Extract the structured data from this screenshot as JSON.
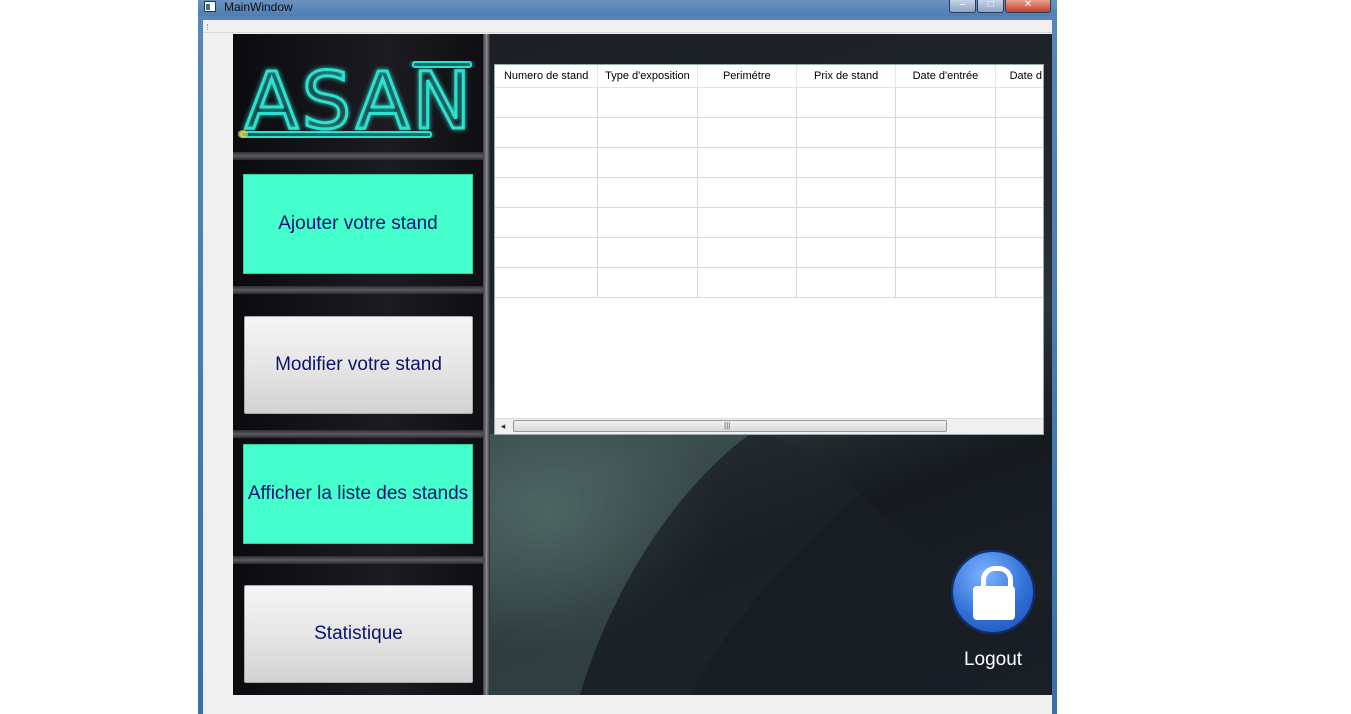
{
  "window": {
    "title": "MainWindow",
    "controls": {
      "minimize": "–",
      "maximize": "□",
      "close": "✕"
    }
  },
  "logo": {
    "text": "ASAN",
    "colors": {
      "glow": "#2de0d0",
      "accent": "#e8d040"
    }
  },
  "nav": {
    "add_stand": "Ajouter votre stand",
    "edit_stand": "Modifier votre stand",
    "list_stands": "Afficher la liste des stands",
    "statistics": "Statistique"
  },
  "table": {
    "columns": [
      "Numero de stand",
      "Type d'exposition",
      "Perimétre",
      "Prix de stand",
      "Date d'entrée",
      "Date d"
    ],
    "row_count": 7,
    "scrollbar": {
      "left_arrow": "◂",
      "grip": "|||"
    }
  },
  "logout": {
    "label": "Logout",
    "icon": "lock-icon"
  },
  "colors": {
    "teal_button": "#44ffcc",
    "button_text": "#0c1370",
    "title_bar": "#4f7db3",
    "logout_blue": "#2f6fd6"
  }
}
